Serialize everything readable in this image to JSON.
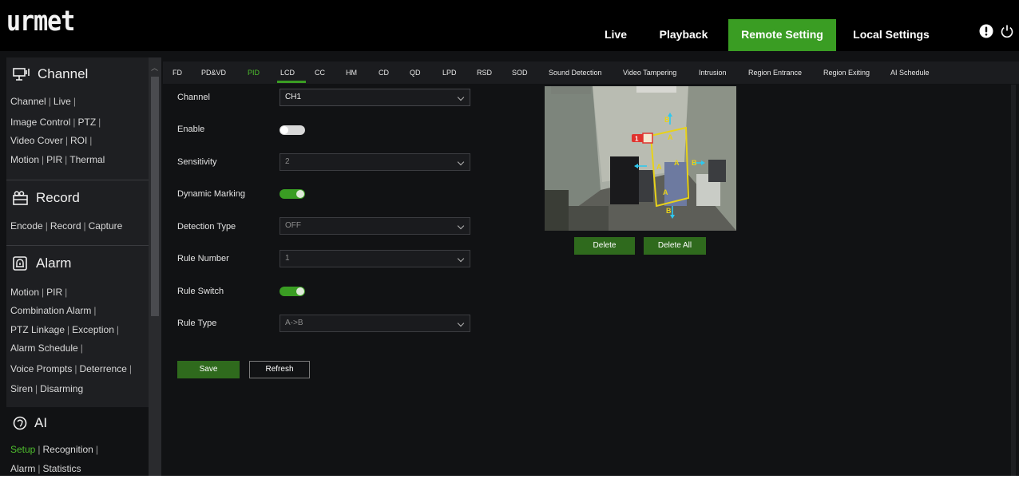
{
  "brand": {
    "logo_text": "urmet"
  },
  "topnav": {
    "items": [
      {
        "label": "Live"
      },
      {
        "label": "Playback"
      },
      {
        "label": "Remote Setting",
        "active": true
      },
      {
        "label": "Local Settings"
      }
    ],
    "icons": [
      "info-icon",
      "power-icon"
    ]
  },
  "sidebar": {
    "channel": {
      "title": "Channel",
      "lines": [
        [
          "Channel",
          "Live"
        ],
        [
          "Image Control",
          "PTZ"
        ],
        [
          "Video Cover",
          "ROI"
        ],
        [
          "Motion",
          "PIR",
          "Thermal"
        ]
      ]
    },
    "record": {
      "title": "Record",
      "lines": [
        [
          "Encode",
          "Record",
          "Capture"
        ]
      ]
    },
    "alarm": {
      "title": "Alarm",
      "lines": [
        [
          "Motion",
          "PIR"
        ],
        [
          "Combination Alarm"
        ],
        [
          "PTZ Linkage",
          "Exception"
        ],
        [
          "Alarm Schedule"
        ],
        [
          "Voice Prompts",
          "Deterrence"
        ],
        [
          "Siren",
          "Disarming"
        ]
      ]
    },
    "ai": {
      "title": "AI",
      "lines": [
        [
          "Setup",
          "Recognition"
        ],
        [
          "Alarm",
          "Statistics"
        ]
      ],
      "active_item": "Setup"
    }
  },
  "tabs": [
    "FD",
    "PD&VD",
    "PID",
    "LCD",
    "CC",
    "HM",
    "CD",
    "QD",
    "LPD",
    "RSD",
    "SOD",
    "Sound Detection",
    "Video Tampering",
    "Intrusion",
    "Region Entrance",
    "Region Exiting",
    "AI Schedule"
  ],
  "active_tab": "LCD",
  "form": {
    "channel": {
      "label": "Channel",
      "value": "CH1"
    },
    "enable": {
      "label": "Enable",
      "on": false
    },
    "sensitivity": {
      "label": "Sensitivity",
      "value": "2"
    },
    "dynamic_marking": {
      "label": "Dynamic Marking",
      "on": true
    },
    "detection_type": {
      "label": "Detection Type",
      "value": "OFF"
    },
    "rule_number": {
      "label": "Rule Number",
      "value": "1"
    },
    "rule_switch": {
      "label": "Rule Switch",
      "on": true
    },
    "rule_type": {
      "label": "Rule Type",
      "value": "A->B"
    }
  },
  "buttons": {
    "save": "Save",
    "refresh": "Refresh",
    "delete": "Delete",
    "delete_all": "Delete All"
  },
  "preview": {
    "rule_index": "1",
    "markers": [
      "A",
      "B",
      "A",
      "B",
      "A",
      "B",
      "A",
      "B"
    ]
  },
  "colors": {
    "accent": "#3a9d23",
    "rule_line": "#e8d21a",
    "direction_arrow": "#2ec8ee",
    "rule_marker": "#e0332e"
  }
}
